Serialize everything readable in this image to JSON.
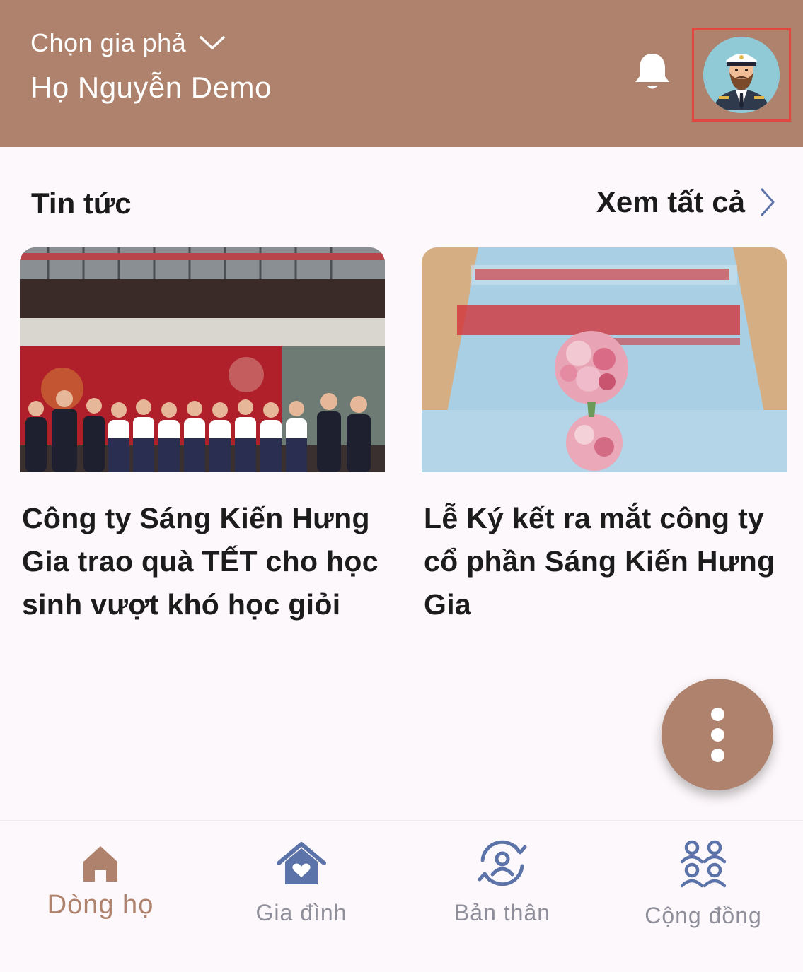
{
  "header": {
    "picker_label": "Chọn gia phả",
    "family_name": "Họ Nguyễn Demo"
  },
  "news": {
    "section_title": "Tin tức",
    "see_all_label": "Xem tất cả",
    "articles": [
      {
        "title": "Công ty Sáng Kiến Hưng Gia trao quà TẾT cho học sinh vượt khó học giỏi"
      },
      {
        "title": "Lễ Ký kết ra mắt công ty cổ phần Sáng Kiến Hưng Gia"
      }
    ]
  },
  "bottom_nav": {
    "items": [
      {
        "label": "Dòng họ",
        "icon": "home-icon",
        "active": true
      },
      {
        "label": "Gia đình",
        "icon": "family-home-icon",
        "active": false
      },
      {
        "label": "Bản thân",
        "icon": "self-profile-icon",
        "active": false
      },
      {
        "label": "Cộng đồng",
        "icon": "community-icon",
        "active": false
      }
    ]
  },
  "colors": {
    "brand": "#ae826c",
    "nav_inactive": "#8f8f9b",
    "nav_icon_inactive": "#5b73a8",
    "highlight_border": "#e2473f"
  }
}
